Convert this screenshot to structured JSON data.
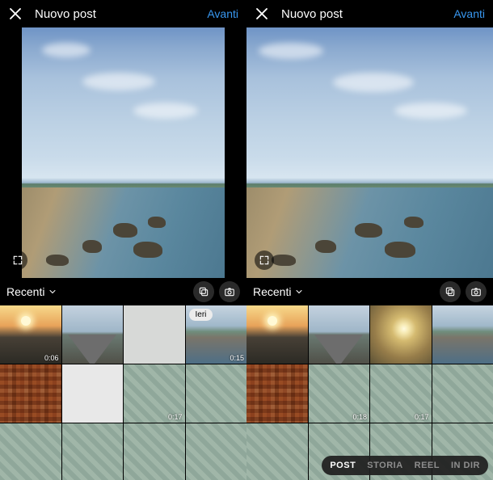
{
  "left": {
    "header": {
      "title": "Nuovo post",
      "next": "Avanti"
    },
    "preview": {
      "expand_icon": true,
      "crop": "tall"
    },
    "gallery_bar": {
      "album_label": "Recenti"
    },
    "thumbs": [
      {
        "kind": "sunset",
        "duration": "0:06"
      },
      {
        "kind": "road",
        "duration": ""
      },
      {
        "kind": "faded",
        "duration": ""
      },
      {
        "kind": "coast",
        "duration": "0:15",
        "chip": "Ieri"
      },
      {
        "kind": "pixelated",
        "duration": ""
      },
      {
        "kind": "white",
        "duration": ""
      },
      {
        "kind": "water",
        "duration": "0:17"
      },
      {
        "kind": "water",
        "duration": ""
      },
      {
        "kind": "water",
        "duration": ""
      },
      {
        "kind": "water",
        "duration": ""
      },
      {
        "kind": "water",
        "duration": ""
      },
      {
        "kind": "water",
        "duration": ""
      }
    ]
  },
  "right": {
    "header": {
      "title": "Nuovo post",
      "next": "Avanti"
    },
    "preview": {
      "expand_icon": true,
      "crop": "square"
    },
    "gallery_bar": {
      "album_label": "Recenti"
    },
    "thumbs": [
      {
        "kind": "sunset",
        "duration": ""
      },
      {
        "kind": "road",
        "duration": ""
      },
      {
        "kind": "sunblur",
        "duration": ""
      },
      {
        "kind": "coast",
        "duration": ""
      },
      {
        "kind": "pixelated",
        "duration": ""
      },
      {
        "kind": "water",
        "duration": "0:18"
      },
      {
        "kind": "water",
        "duration": "0:17"
      },
      {
        "kind": "water",
        "duration": ""
      },
      {
        "kind": "water",
        "duration": ""
      },
      {
        "kind": "water",
        "duration": ""
      },
      {
        "kind": "water",
        "duration": ""
      },
      {
        "kind": "water",
        "duration": ""
      }
    ],
    "modes": {
      "items": [
        "POST",
        "STORIA",
        "REEL",
        "IN DIR"
      ],
      "active_index": 0
    }
  },
  "colors": {
    "accent": "#3897f0"
  }
}
